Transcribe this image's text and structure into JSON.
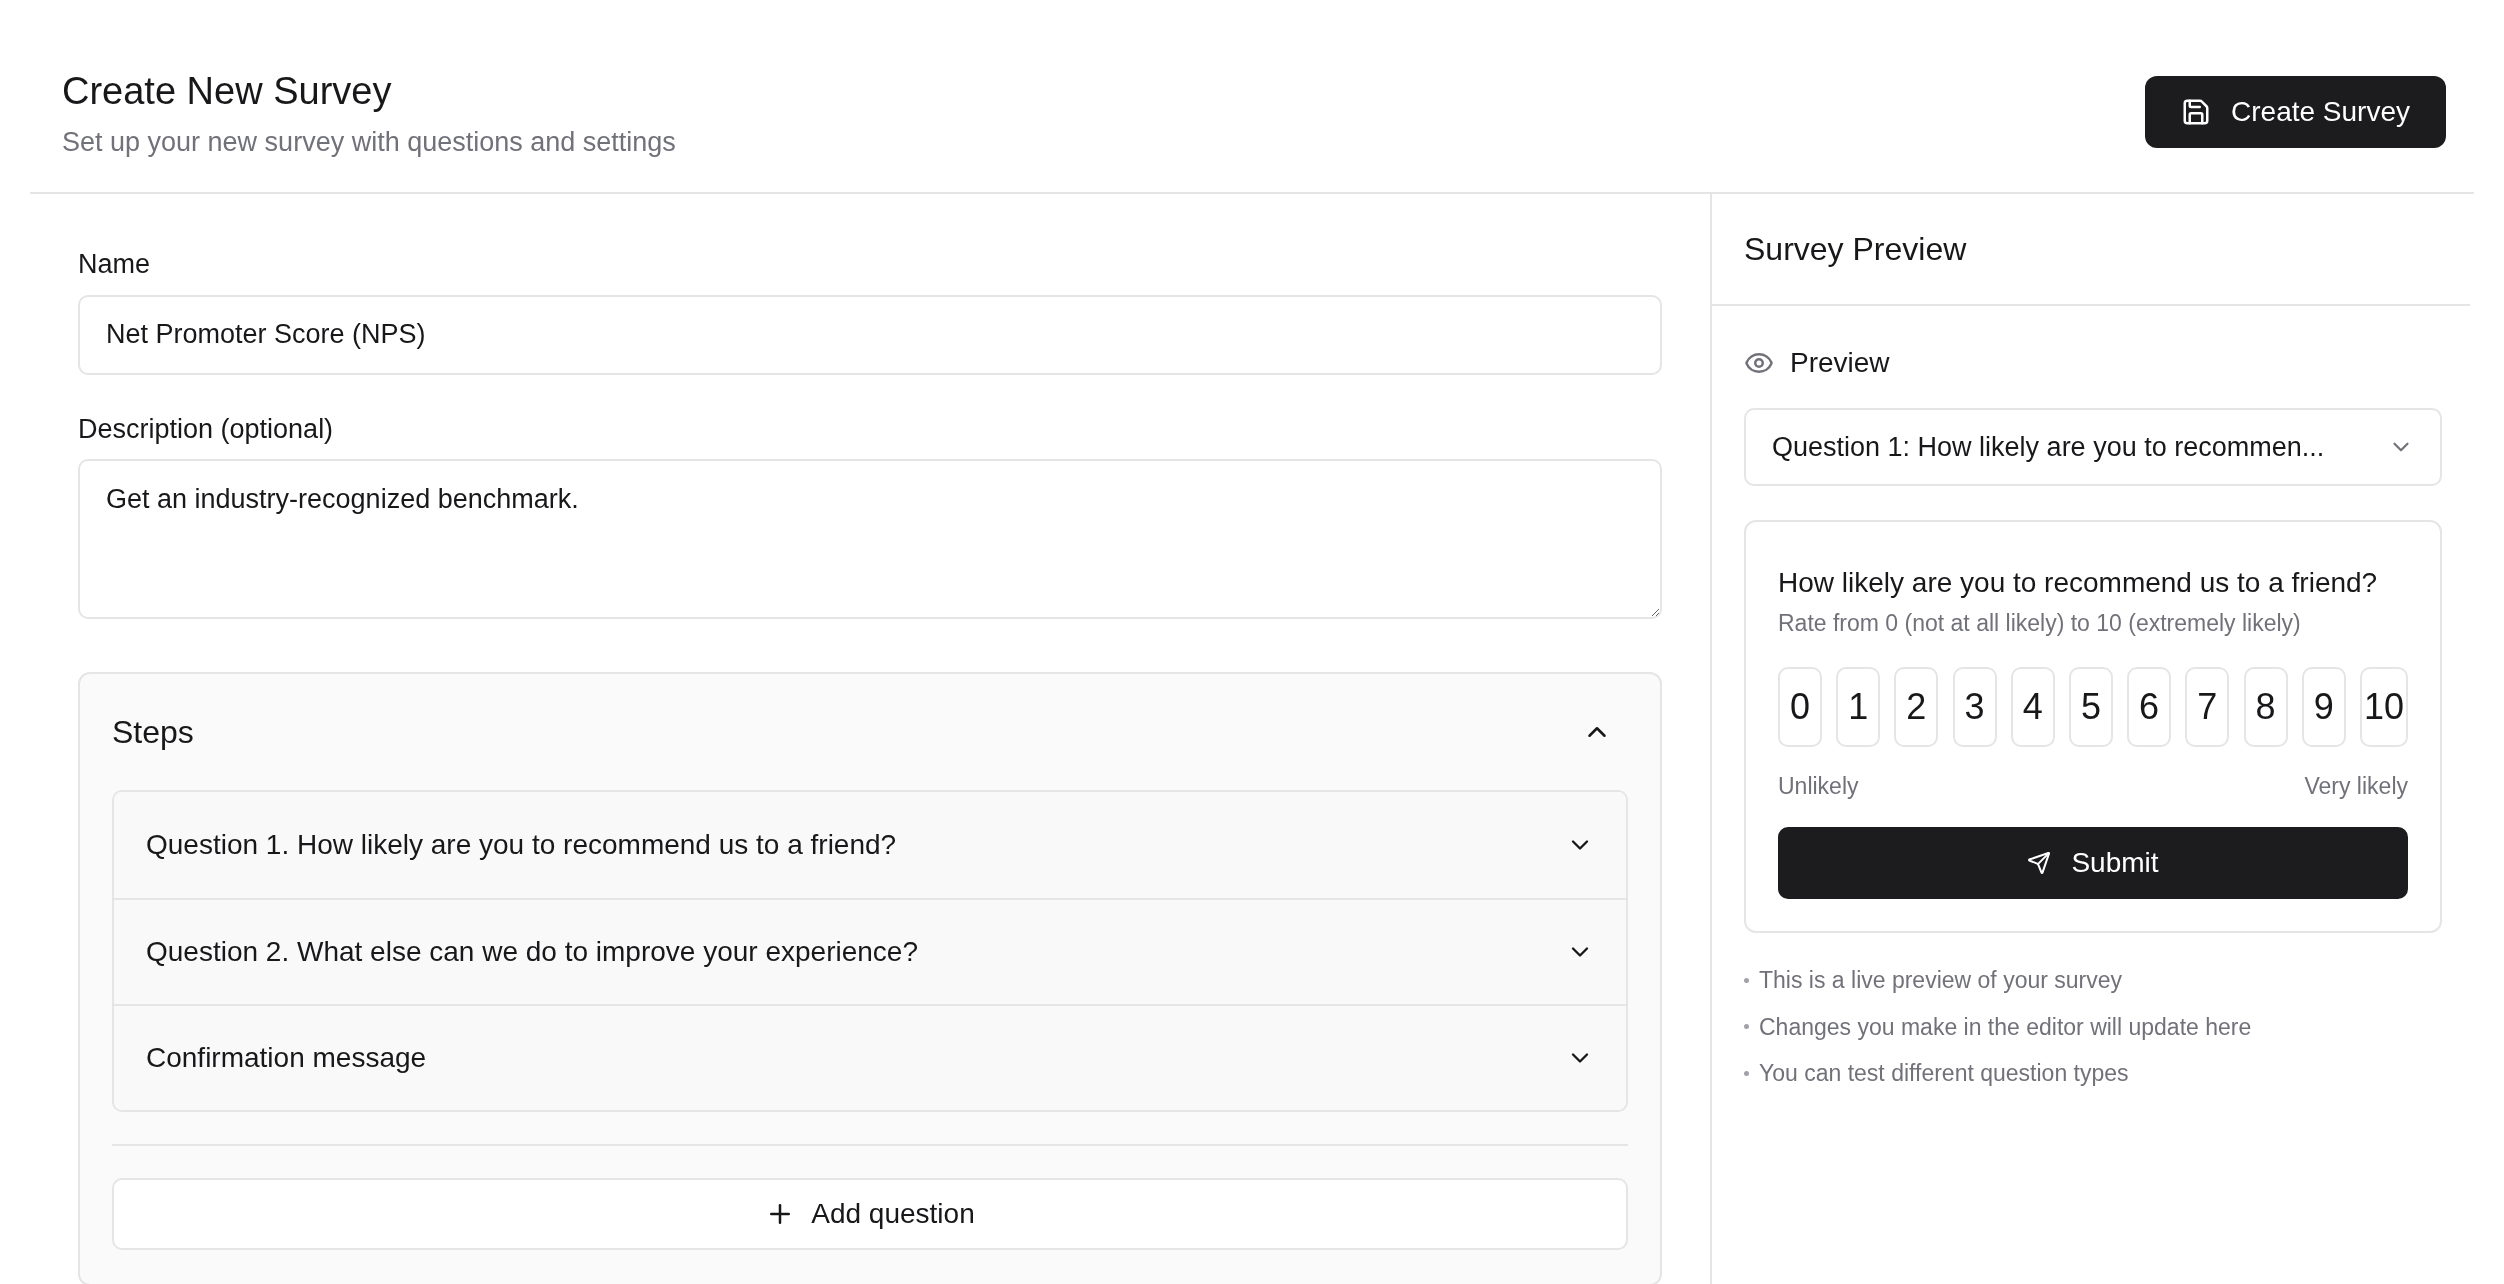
{
  "header": {
    "title": "Create New Survey",
    "subtitle": "Set up your new survey with questions and settings",
    "button": "Create Survey"
  },
  "form": {
    "name_label": "Name",
    "name_value": "Net Promoter Score (NPS)",
    "description_label": "Description (optional)",
    "description_value": "Get an industry-recognized benchmark."
  },
  "steps": {
    "title": "Steps",
    "expanded": true,
    "items": [
      {
        "label": "Question 1. How likely are you to recommend us to a friend?",
        "expanded": false
      },
      {
        "label": "Question 2. What else can we do to improve your experience?",
        "expanded": false
      },
      {
        "label": "Confirmation message",
        "expanded": false
      }
    ],
    "add_button": "Add question"
  },
  "preview": {
    "title": "Survey Preview",
    "section": "Preview",
    "select_value": "Question 1: How likely are you to recommen...",
    "question": "How likely are you to recommend us to a friend?",
    "hint": "Rate from 0 (not at all likely) to 10 (extremely likely)",
    "scale": [
      {
        "label": "0",
        "selected": false
      },
      {
        "label": "1",
        "selected": false
      },
      {
        "label": "2",
        "selected": false
      },
      {
        "label": "3",
        "selected": false
      },
      {
        "label": "4",
        "selected": false
      },
      {
        "label": "5",
        "selected": false
      },
      {
        "label": "6",
        "selected": false
      },
      {
        "label": "7",
        "selected": false
      },
      {
        "label": "8",
        "selected": false
      },
      {
        "label": "9",
        "selected": false
      },
      {
        "label": "10",
        "selected": false
      }
    ],
    "low_label": "Unlikely",
    "high_label": "Very likely",
    "submit": "Submit",
    "notes": [
      "This is a live preview of your survey",
      "Changes you make in the editor will update here",
      "You can test different question types"
    ]
  }
}
